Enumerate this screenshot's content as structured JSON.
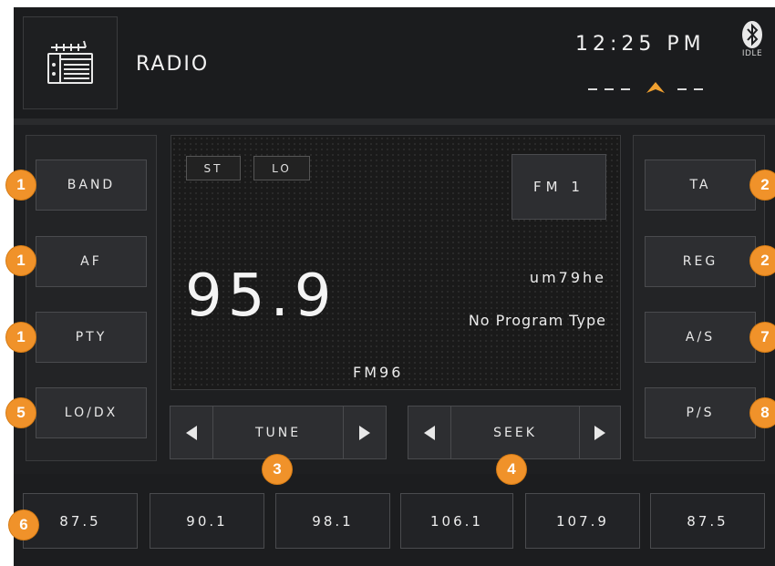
{
  "header": {
    "title": "RADIO",
    "clock": "12:25 PM",
    "bluetooth_status": "IDLE",
    "compass": "--- ▲--",
    "radio_icon": "radio-icon",
    "bluetooth_icon": "bluetooth-icon"
  },
  "left_buttons": [
    "BAND",
    "AF",
    "PTY",
    "LO/DX"
  ],
  "right_buttons": [
    "TA",
    "REG",
    "A/S",
    "P/S"
  ],
  "display": {
    "tags": [
      "ST",
      "LO"
    ],
    "band": "FM 1",
    "frequency": "95.9",
    "ps_name": "um79he",
    "program_type": "No Program Type",
    "station": "FM96"
  },
  "controls": {
    "tune_label": "TUNE",
    "seek_label": "SEEK"
  },
  "presets": [
    "87.5",
    "90.1",
    "98.1",
    "106.1",
    "107.9",
    "87.5"
  ],
  "badges": {
    "band": "1",
    "af": "1",
    "pty": "1",
    "lodx": "5",
    "ta": "2",
    "reg": "2",
    "as": "7",
    "ps": "8",
    "tune": "3",
    "seek": "4",
    "presets": "6"
  },
  "colors": {
    "badge": "#f0922a",
    "background": "#1e1f21",
    "compass_arrow": "#f0a030"
  }
}
